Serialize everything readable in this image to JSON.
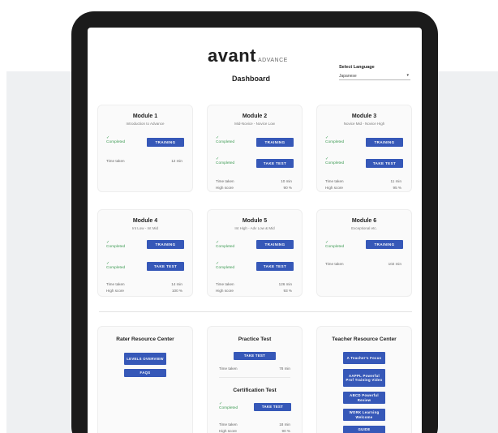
{
  "header": {
    "logo_main": "avant",
    "logo_sub": "ADVANCE",
    "title": "Dashboard",
    "language_label": "Select Language",
    "language_value": "Japanese"
  },
  "modules": [
    {
      "title": "Module 1",
      "subtitle": "Introduction to Advance",
      "status": "Completed",
      "training_label": "TRAINING",
      "time_label": "Time taken",
      "time_value": "12 min"
    },
    {
      "title": "Module 2",
      "subtitle": "Mid-Novice - Novice Low",
      "status1": "Completed",
      "training_label": "TRAINING",
      "status2": "Completed",
      "test_label": "TAKE TEST",
      "time_label": "Time taken",
      "time_value": "10 min",
      "score_label": "High score",
      "score_value": "90 %"
    },
    {
      "title": "Module 3",
      "subtitle": "Novice Mid - Novice High",
      "status1": "Completed",
      "training_label": "TRAINING",
      "status2": "Completed",
      "test_label": "TAKE TEST",
      "time_label": "Time taken",
      "time_value": "11 min",
      "score_label": "High score",
      "score_value": "95 %"
    },
    {
      "title": "Module 4",
      "subtitle": "Int Low - Int Mid",
      "status1": "Completed",
      "training_label": "TRAINING",
      "status2": "Completed",
      "test_label": "TAKE TEST",
      "time_label": "Time taken",
      "time_value": "14 min",
      "score_label": "High score",
      "score_value": "100 %"
    },
    {
      "title": "Module 5",
      "subtitle": "Int High - Adv Low & Mid",
      "status1": "Completed",
      "training_label": "TRAINING",
      "status2": "Completed",
      "test_label": "TAKE TEST",
      "time_label": "Time taken",
      "time_value": "126 min",
      "score_label": "High score",
      "score_value": "93 %"
    },
    {
      "title": "Module 6",
      "subtitle": "Exceptional etc.",
      "status1": "Completed",
      "training_label": "TRAINING",
      "time_label": "Time taken",
      "time_value": "102 min"
    }
  ],
  "resources": {
    "rater": {
      "title": "Rater Resource Center",
      "btn1": "LEVELS OVERVIEW",
      "btn2": "FAQS"
    },
    "practice": {
      "title": "Practice Test",
      "btn": "TAKE TEST",
      "time_label": "Time taken",
      "time_value": "78 min"
    },
    "cert": {
      "title": "Certification Test",
      "status": "Completed",
      "btn": "TAKE TEST",
      "time_label": "Time taken",
      "time_value": "18 min",
      "score_label": "High score",
      "score_value": "90 %"
    },
    "teacher": {
      "title": "Teacher Resource Center",
      "btn1": "A Teacher's Focus",
      "btn2": "AAPPL Powerful Prof Training Video",
      "btn3": "ABCD Powerful Review",
      "btn4": "WORK Learning Welcome",
      "btn5": "GUIDE"
    }
  },
  "colors": {
    "accent": "#3658b8",
    "success": "#3f9c55"
  }
}
